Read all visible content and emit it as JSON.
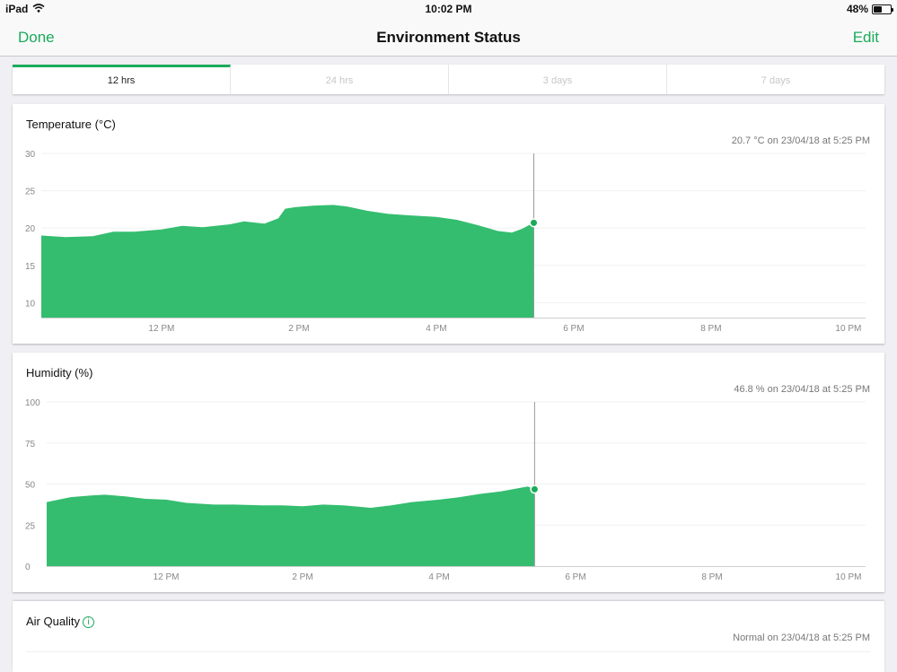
{
  "status_bar": {
    "device": "iPad",
    "time": "10:02 PM",
    "battery": "48%",
    "battery_level": 0.48
  },
  "nav": {
    "left_button": "Done",
    "title": "Environment Status",
    "right_button": "Edit"
  },
  "tabs": [
    {
      "label": "12 hrs",
      "active": true
    },
    {
      "label": "24 hrs",
      "active": false
    },
    {
      "label": "3 days",
      "active": false
    },
    {
      "label": "7 days",
      "active": false
    }
  ],
  "temperature": {
    "title": "Temperature (°C)",
    "reading": "20.7 °C on 23/04/18 at 5:25 PM"
  },
  "humidity": {
    "title": "Humidity (%)",
    "reading": "46.8 % on 23/04/18 at 5:25 PM"
  },
  "air_quality": {
    "title": "Air Quality",
    "reading": "Normal on 23/04/18 at 5:25 PM"
  },
  "colors": {
    "accent": "#1aab5a",
    "fill": "#34bd6f"
  },
  "chart_data": [
    {
      "type": "area",
      "title": "Temperature (°C)",
      "ylim": [
        8,
        30
      ],
      "yticks": [
        10,
        15,
        20,
        25,
        30
      ],
      "xlim": [
        10.25,
        22.25
      ],
      "xticks": [
        12,
        14,
        16,
        18,
        20,
        22
      ],
      "xtick_labels": [
        "12 PM",
        "2 PM",
        "4 PM",
        "6 PM",
        "8 PM",
        "10 PM"
      ],
      "x": [
        10.25,
        10.6,
        11.0,
        11.3,
        11.6,
        12.0,
        12.3,
        12.6,
        13.0,
        13.2,
        13.5,
        13.7,
        13.8,
        13.95,
        14.2,
        14.5,
        14.7,
        15.0,
        15.3,
        15.6,
        16.0,
        16.3,
        16.6,
        16.9,
        17.1,
        17.25,
        17.35,
        17.42
      ],
      "y": [
        19.0,
        18.8,
        18.9,
        19.5,
        19.5,
        19.8,
        20.3,
        20.1,
        20.5,
        20.9,
        20.6,
        21.3,
        22.6,
        22.8,
        23.0,
        23.1,
        22.9,
        22.3,
        21.9,
        21.7,
        21.5,
        21.1,
        20.4,
        19.6,
        19.4,
        19.9,
        20.4,
        20.7
      ],
      "grid": true
    },
    {
      "type": "area",
      "title": "Humidity (%)",
      "ylim": [
        0,
        100
      ],
      "yticks": [
        0,
        25,
        50,
        75,
        100
      ],
      "xlim": [
        10.25,
        22.25
      ],
      "xticks": [
        12,
        14,
        16,
        18,
        20,
        22
      ],
      "xtick_labels": [
        "12 PM",
        "2 PM",
        "4 PM",
        "6 PM",
        "8 PM",
        "10 PM"
      ],
      "x": [
        10.25,
        10.6,
        10.9,
        11.1,
        11.4,
        11.7,
        12.0,
        12.3,
        12.7,
        13.0,
        13.4,
        13.7,
        14.0,
        14.3,
        14.6,
        15.0,
        15.3,
        15.6,
        16.0,
        16.3,
        16.6,
        16.9,
        17.1,
        17.3,
        17.4
      ],
      "y": [
        39,
        42,
        43,
        43.5,
        42.5,
        41,
        40.5,
        38.5,
        37.5,
        37.5,
        37,
        37,
        36.5,
        37.5,
        37,
        35.5,
        37,
        39,
        40.5,
        42,
        44,
        45.5,
        47,
        48.5,
        46.8
      ],
      "grid": true
    }
  ]
}
